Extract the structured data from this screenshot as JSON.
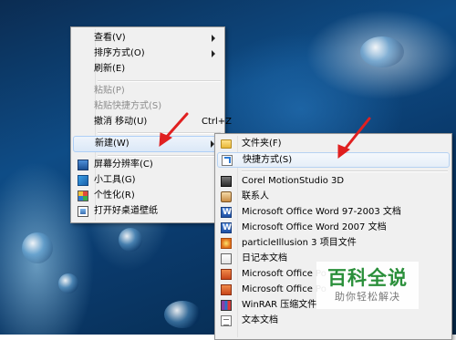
{
  "context_menu": {
    "items": [
      {
        "label": "查看(V)",
        "submenu": true
      },
      {
        "label": "排序方式(O)",
        "submenu": true
      },
      {
        "label": "刷新(E)"
      },
      {
        "label": "粘贴(P)",
        "disabled": true
      },
      {
        "label": "粘贴快捷方式(S)",
        "disabled": true
      },
      {
        "label": "撤消 移动(U)",
        "shortcut": "Ctrl+Z"
      },
      {
        "label": "新建(W)",
        "submenu": true,
        "highlighted": true
      },
      {
        "label": "屏幕分辨率(C)",
        "icon": "display-icon"
      },
      {
        "label": "小工具(G)",
        "icon": "gadgets-icon"
      },
      {
        "label": "个性化(R)",
        "icon": "personalize-icon"
      },
      {
        "label": "打开好桌道壁纸",
        "icon": "wallpaper-icon"
      }
    ]
  },
  "new_submenu": {
    "items": [
      {
        "label": "文件夹(F)",
        "icon": "folder-icon"
      },
      {
        "label": "快捷方式(S)",
        "icon": "shortcut-icon",
        "highlighted": true
      },
      {
        "label": "Corel MotionStudio 3D",
        "icon": "corel-icon"
      },
      {
        "label": "联系人",
        "icon": "contact-icon"
      },
      {
        "label": "Microsoft Office Word 97-2003 文档",
        "icon": "word-icon"
      },
      {
        "label": "Microsoft Office Word 2007 文档",
        "icon": "word-icon"
      },
      {
        "label": "particleIllusion 3 项目文件",
        "icon": "particle-icon"
      },
      {
        "label": "日记本文档",
        "icon": "journal-icon"
      },
      {
        "label": "Microsoft Office Po",
        "icon": "powerpoint-icon"
      },
      {
        "label": "Microsoft Office Po",
        "icon": "powerpoint-icon"
      },
      {
        "label": "WinRAR 压缩文件",
        "icon": "winrar-icon"
      },
      {
        "label": "文本文档",
        "icon": "text-icon"
      }
    ]
  },
  "watermark": {
    "title": "百科全说",
    "subtitle": "助你轻松解决"
  },
  "colors": {
    "menu_bg": "#f0f0f0",
    "highlight_border": "#aecff7",
    "arrow_red": "#e02020",
    "watermark_green": "#2a8f3a"
  }
}
